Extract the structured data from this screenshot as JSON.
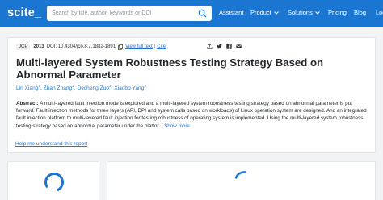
{
  "nav": {
    "logo": "scite_",
    "search_placeholder": "Search by title, author, keywords or DOI",
    "links": {
      "assistant": "Assistant",
      "product": "Product",
      "solutions": "Solutions",
      "pricing": "Pricing",
      "blog": "Blog",
      "log": "Log"
    }
  },
  "paper": {
    "journal": "JCP",
    "year": "2013",
    "doi": "DOI: 10.4304/jcp.8.7.1882-1891",
    "view_full_text": "View full text",
    "separator": "|",
    "cite": "Cite",
    "title": "Multi-layered System Robustness Testing Strategy Based on Abnormal Parameter",
    "authors": [
      {
        "name": "Lin Xiang",
        "sup": "1"
      },
      {
        "name": "Zhan Zhang",
        "sup": "2"
      },
      {
        "name": "Decheng Zuo",
        "sup": "3"
      },
      {
        "name": "Xiaobo Yang",
        "sup": "4"
      }
    ],
    "abstract_label": "Abstract:",
    "abstract_text": "A multi-layered fault injection mode is explored and a multi-layered system robustness testing strategy based on abnormal parameter is put forward. Fault injection methods for three layers (API, DPI and system calls based on workloads) of Linux operation system are designed. And an integrated fault injection platform to multi-layered fault injection for testing robustness of operating system is implemented. Using the multi-layered system robustness testing strategy based on abnormal parameter under the platfor...",
    "show_more": "Show more"
  },
  "help_link": "Help me understand this report",
  "colors": {
    "brand": "#1b76d1",
    "background": "#f1f3f4"
  },
  "icons": [
    "search-icon",
    "copy-icon",
    "share-icon",
    "twitter-icon",
    "facebook-icon",
    "email-icon",
    "loading-spinner-icon"
  ]
}
